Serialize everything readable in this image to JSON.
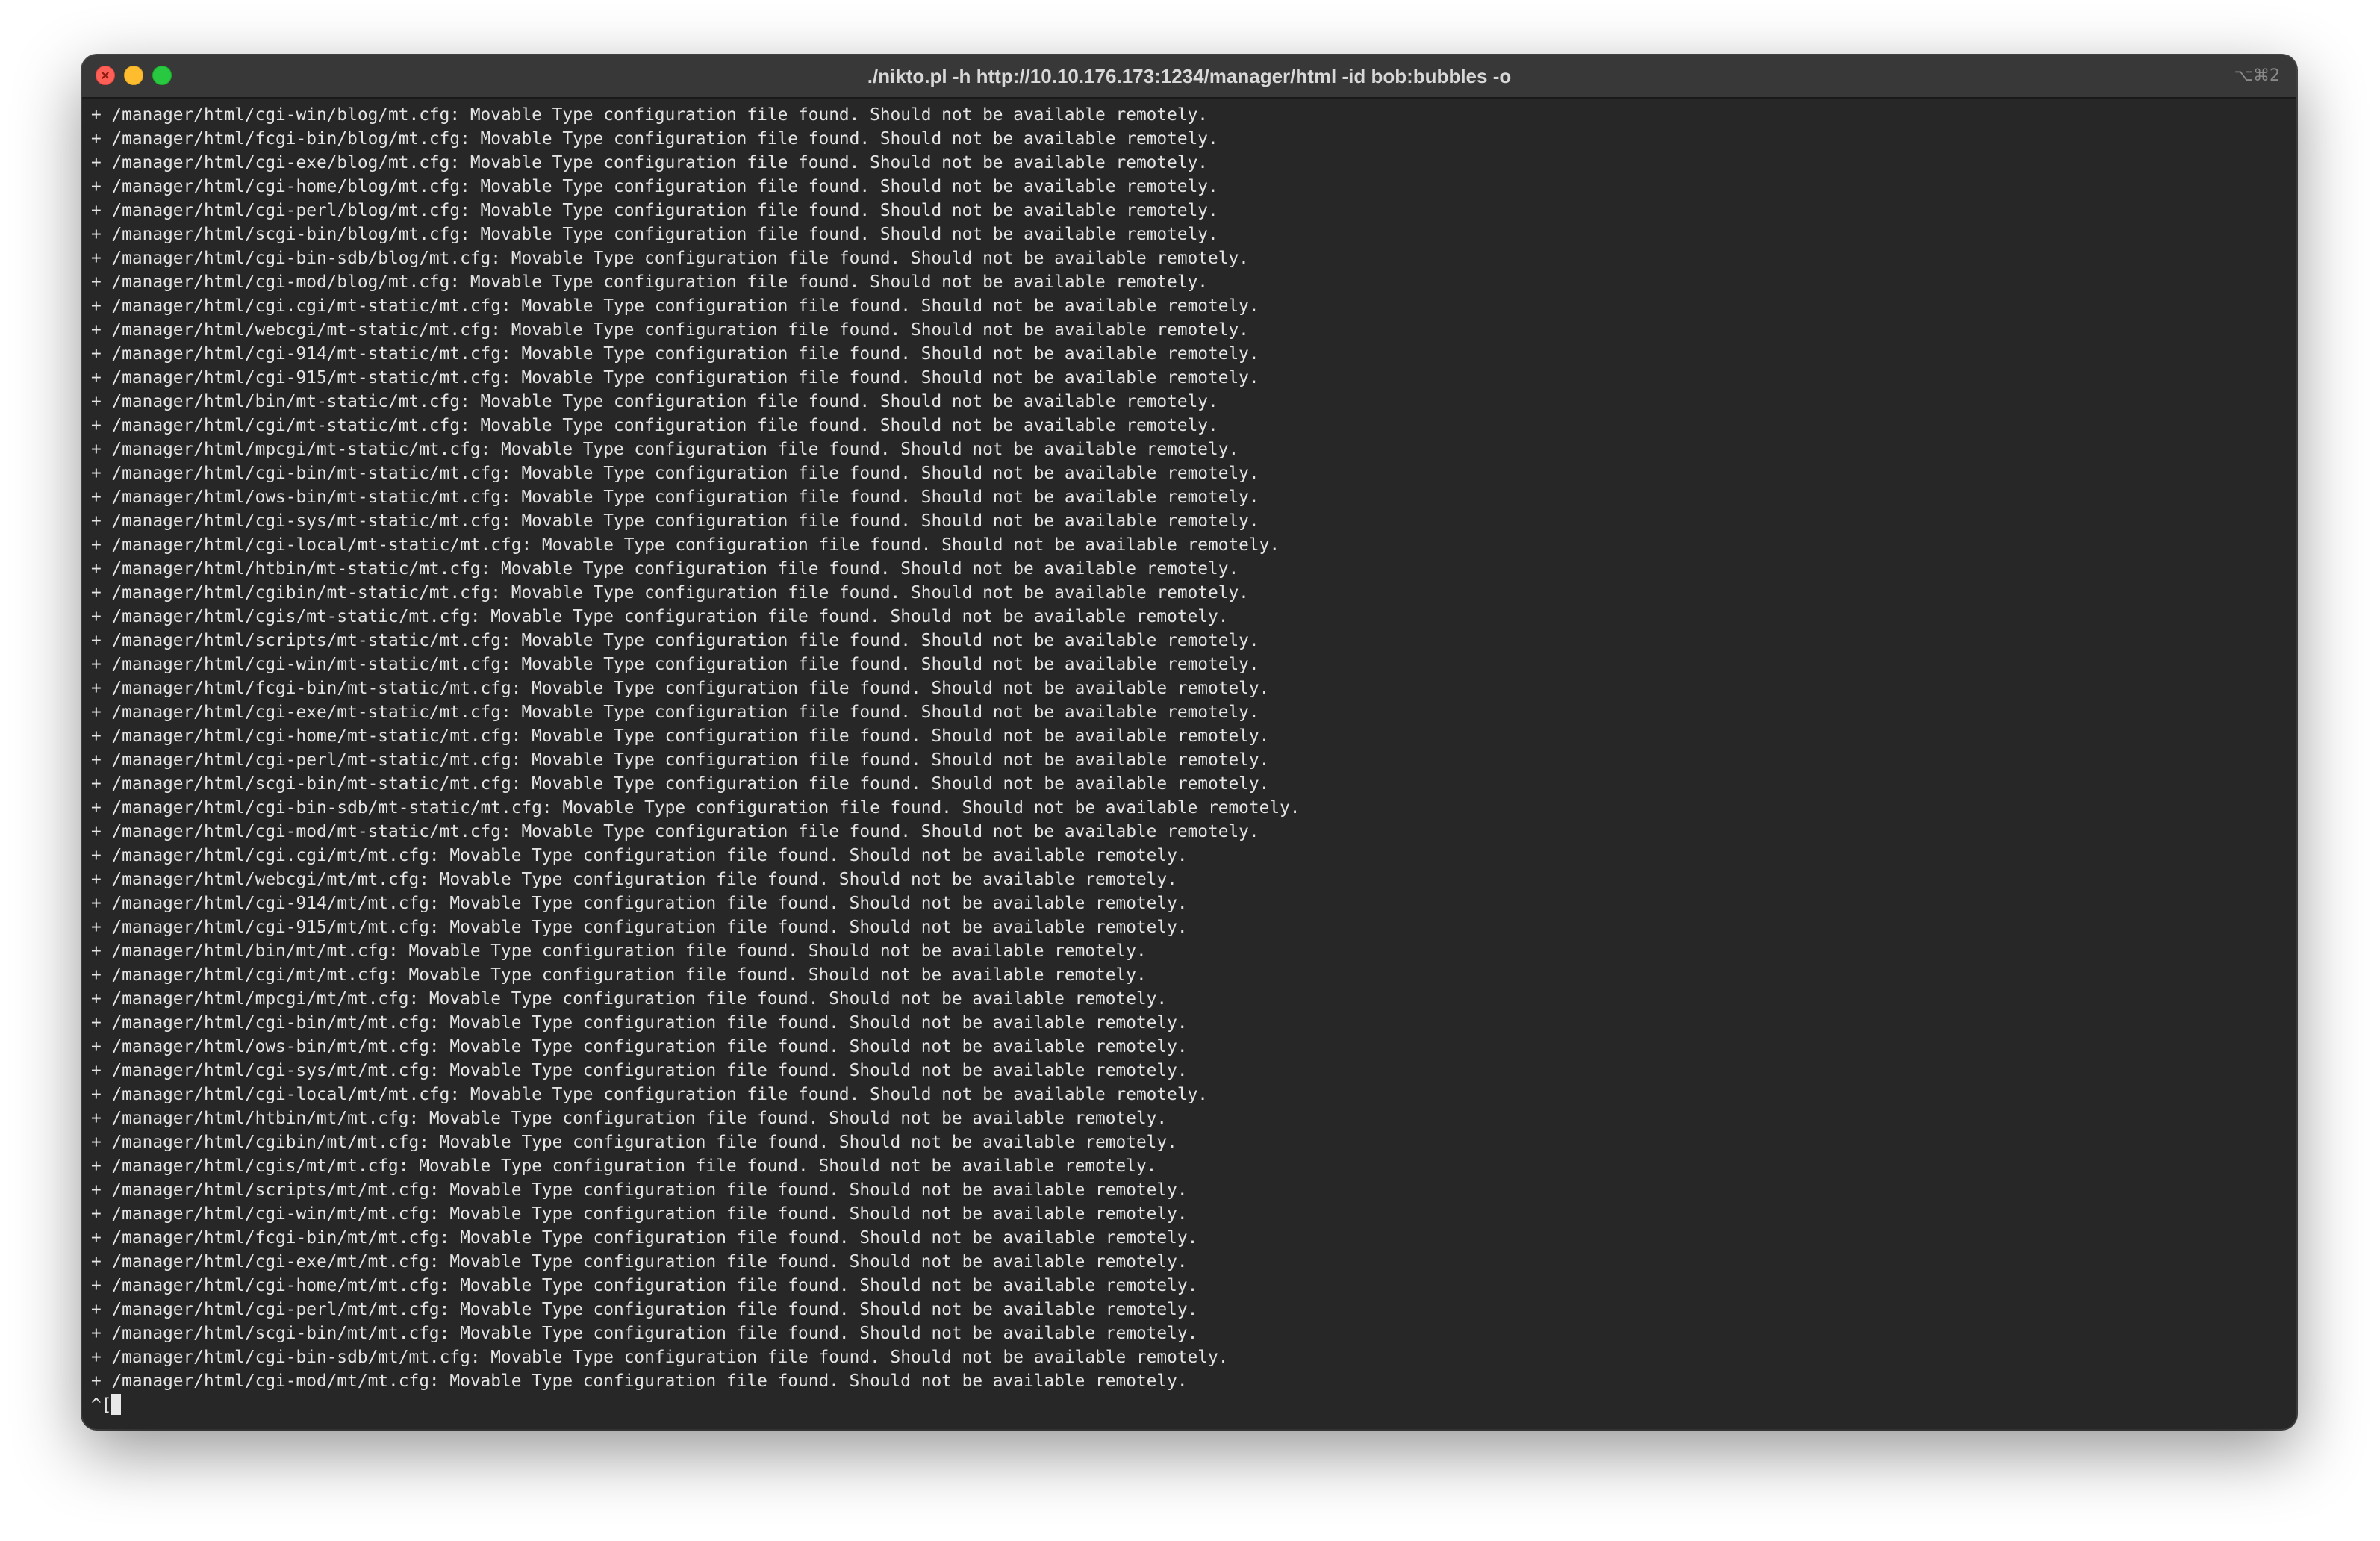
{
  "window": {
    "title": "./nikto.pl -h http://10.10.176.173:1234/manager/html -id bob:bubbles -o",
    "shortcut": "⌥⌘2"
  },
  "terminal": {
    "lines": [
      "+ /manager/html/cgi-win/blog/mt.cfg: Movable Type configuration file found. Should not be available remotely.",
      "+ /manager/html/fcgi-bin/blog/mt.cfg: Movable Type configuration file found. Should not be available remotely.",
      "+ /manager/html/cgi-exe/blog/mt.cfg: Movable Type configuration file found. Should not be available remotely.",
      "+ /manager/html/cgi-home/blog/mt.cfg: Movable Type configuration file found. Should not be available remotely.",
      "+ /manager/html/cgi-perl/blog/mt.cfg: Movable Type configuration file found. Should not be available remotely.",
      "+ /manager/html/scgi-bin/blog/mt.cfg: Movable Type configuration file found. Should not be available remotely.",
      "+ /manager/html/cgi-bin-sdb/blog/mt.cfg: Movable Type configuration file found. Should not be available remotely.",
      "+ /manager/html/cgi-mod/blog/mt.cfg: Movable Type configuration file found. Should not be available remotely.",
      "+ /manager/html/cgi.cgi/mt-static/mt.cfg: Movable Type configuration file found. Should not be available remotely.",
      "+ /manager/html/webcgi/mt-static/mt.cfg: Movable Type configuration file found. Should not be available remotely.",
      "+ /manager/html/cgi-914/mt-static/mt.cfg: Movable Type configuration file found. Should not be available remotely.",
      "+ /manager/html/cgi-915/mt-static/mt.cfg: Movable Type configuration file found. Should not be available remotely.",
      "+ /manager/html/bin/mt-static/mt.cfg: Movable Type configuration file found. Should not be available remotely.",
      "+ /manager/html/cgi/mt-static/mt.cfg: Movable Type configuration file found. Should not be available remotely.",
      "+ /manager/html/mpcgi/mt-static/mt.cfg: Movable Type configuration file found. Should not be available remotely.",
      "+ /manager/html/cgi-bin/mt-static/mt.cfg: Movable Type configuration file found. Should not be available remotely.",
      "+ /manager/html/ows-bin/mt-static/mt.cfg: Movable Type configuration file found. Should not be available remotely.",
      "+ /manager/html/cgi-sys/mt-static/mt.cfg: Movable Type configuration file found. Should not be available remotely.",
      "+ /manager/html/cgi-local/mt-static/mt.cfg: Movable Type configuration file found. Should not be available remotely.",
      "+ /manager/html/htbin/mt-static/mt.cfg: Movable Type configuration file found. Should not be available remotely.",
      "+ /manager/html/cgibin/mt-static/mt.cfg: Movable Type configuration file found. Should not be available remotely.",
      "+ /manager/html/cgis/mt-static/mt.cfg: Movable Type configuration file found. Should not be available remotely.",
      "+ /manager/html/scripts/mt-static/mt.cfg: Movable Type configuration file found. Should not be available remotely.",
      "+ /manager/html/cgi-win/mt-static/mt.cfg: Movable Type configuration file found. Should not be available remotely.",
      "+ /manager/html/fcgi-bin/mt-static/mt.cfg: Movable Type configuration file found. Should not be available remotely.",
      "+ /manager/html/cgi-exe/mt-static/mt.cfg: Movable Type configuration file found. Should not be available remotely.",
      "+ /manager/html/cgi-home/mt-static/mt.cfg: Movable Type configuration file found. Should not be available remotely.",
      "+ /manager/html/cgi-perl/mt-static/mt.cfg: Movable Type configuration file found. Should not be available remotely.",
      "+ /manager/html/scgi-bin/mt-static/mt.cfg: Movable Type configuration file found. Should not be available remotely.",
      "+ /manager/html/cgi-bin-sdb/mt-static/mt.cfg: Movable Type configuration file found. Should not be available remotely.",
      "+ /manager/html/cgi-mod/mt-static/mt.cfg: Movable Type configuration file found. Should not be available remotely.",
      "+ /manager/html/cgi.cgi/mt/mt.cfg: Movable Type configuration file found. Should not be available remotely.",
      "+ /manager/html/webcgi/mt/mt.cfg: Movable Type configuration file found. Should not be available remotely.",
      "+ /manager/html/cgi-914/mt/mt.cfg: Movable Type configuration file found. Should not be available remotely.",
      "+ /manager/html/cgi-915/mt/mt.cfg: Movable Type configuration file found. Should not be available remotely.",
      "+ /manager/html/bin/mt/mt.cfg: Movable Type configuration file found. Should not be available remotely.",
      "+ /manager/html/cgi/mt/mt.cfg: Movable Type configuration file found. Should not be available remotely.",
      "+ /manager/html/mpcgi/mt/mt.cfg: Movable Type configuration file found. Should not be available remotely.",
      "+ /manager/html/cgi-bin/mt/mt.cfg: Movable Type configuration file found. Should not be available remotely.",
      "+ /manager/html/ows-bin/mt/mt.cfg: Movable Type configuration file found. Should not be available remotely.",
      "+ /manager/html/cgi-sys/mt/mt.cfg: Movable Type configuration file found. Should not be available remotely.",
      "+ /manager/html/cgi-local/mt/mt.cfg: Movable Type configuration file found. Should not be available remotely.",
      "+ /manager/html/htbin/mt/mt.cfg: Movable Type configuration file found. Should not be available remotely.",
      "+ /manager/html/cgibin/mt/mt.cfg: Movable Type configuration file found. Should not be available remotely.",
      "+ /manager/html/cgis/mt/mt.cfg: Movable Type configuration file found. Should not be available remotely.",
      "+ /manager/html/scripts/mt/mt.cfg: Movable Type configuration file found. Should not be available remotely.",
      "+ /manager/html/cgi-win/mt/mt.cfg: Movable Type configuration file found. Should not be available remotely.",
      "+ /manager/html/fcgi-bin/mt/mt.cfg: Movable Type configuration file found. Should not be available remotely.",
      "+ /manager/html/cgi-exe/mt/mt.cfg: Movable Type configuration file found. Should not be available remotely.",
      "+ /manager/html/cgi-home/mt/mt.cfg: Movable Type configuration file found. Should not be available remotely.",
      "+ /manager/html/cgi-perl/mt/mt.cfg: Movable Type configuration file found. Should not be available remotely.",
      "+ /manager/html/scgi-bin/mt/mt.cfg: Movable Type configuration file found. Should not be available remotely.",
      "+ /manager/html/cgi-bin-sdb/mt/mt.cfg: Movable Type configuration file found. Should not be available remotely.",
      "+ /manager/html/cgi-mod/mt/mt.cfg: Movable Type configuration file found. Should not be available remotely."
    ],
    "prompt": "^["
  }
}
